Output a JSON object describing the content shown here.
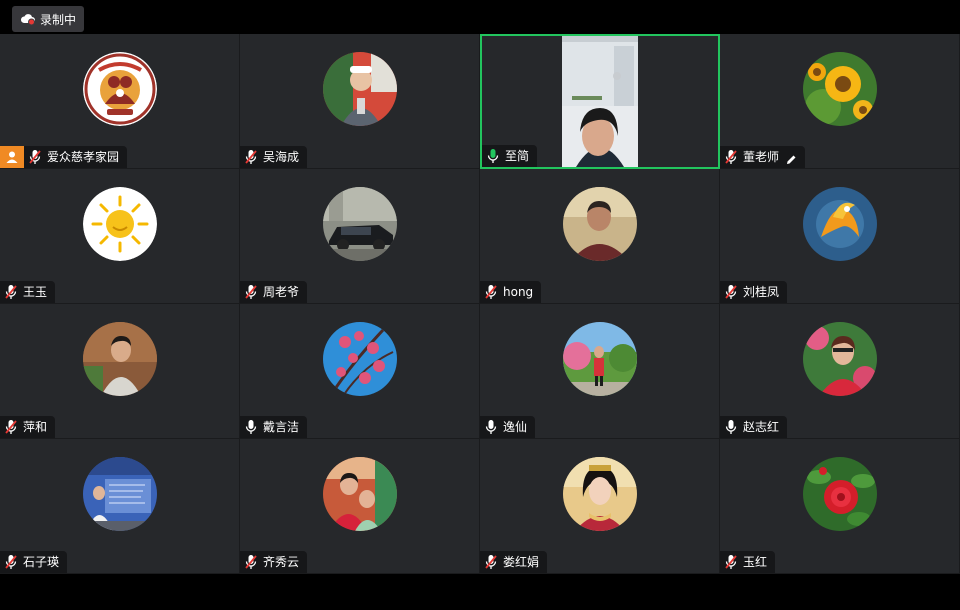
{
  "recording": {
    "label": "录制中"
  },
  "participants": [
    {
      "name": "爱众慈孝家园",
      "mic": "muted",
      "host": true
    },
    {
      "name": "吴海成",
      "mic": "muted"
    },
    {
      "name": "至简",
      "mic": "active",
      "video": true
    },
    {
      "name": "董老师",
      "mic": "muted",
      "pen": true
    },
    {
      "name": "王玉",
      "mic": "muted"
    },
    {
      "name": "周老爷",
      "mic": "muted"
    },
    {
      "name": "hong",
      "mic": "muted"
    },
    {
      "name": "刘桂凤",
      "mic": "muted"
    },
    {
      "name": "萍和",
      "mic": "muted"
    },
    {
      "name": "戴言洁",
      "mic": "on"
    },
    {
      "name": "逸仙",
      "mic": "on"
    },
    {
      "name": "赵志红",
      "mic": "on"
    },
    {
      "name": "石子瑛",
      "mic": "muted"
    },
    {
      "name": "齐秀云",
      "mic": "muted"
    },
    {
      "name": "娄红娟",
      "mic": "muted"
    },
    {
      "name": "玉红",
      "mic": "muted"
    }
  ],
  "colors": {
    "tile_bg": "#26282b",
    "active_border": "#22c55e",
    "host_badge": "#f08a24",
    "mute_slash": "#e53935"
  }
}
